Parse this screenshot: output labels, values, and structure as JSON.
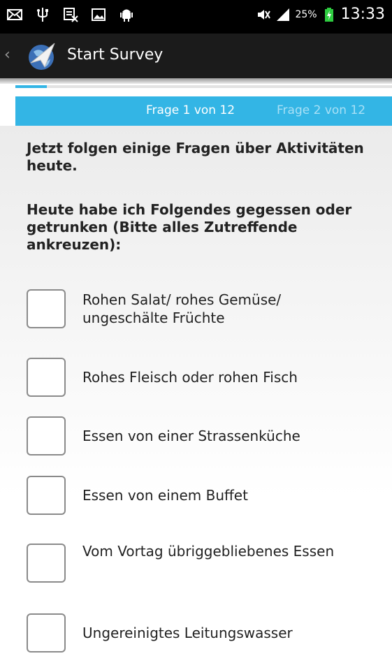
{
  "status_bar": {
    "battery_percent": "25%",
    "time": "13:33",
    "left_icons": [
      "mail-icon",
      "usb-icon",
      "sim-icon",
      "image-icon",
      "android-icon"
    ],
    "right_icons": [
      "mute-icon",
      "signal-icon",
      "battery-icon"
    ]
  },
  "action_bar": {
    "title": "Start Survey",
    "icons": [
      "back-chevron-icon",
      "app-logo-icon"
    ]
  },
  "progress": {
    "value_fraction": 0.083
  },
  "pager": {
    "current": "Frage 1 von 12",
    "next": "Frage 2 von 12"
  },
  "survey": {
    "intro": "Jetzt folgen einige Fragen über Aktivitäten heute.",
    "question": "Heute habe ich Folgendes gegessen oder getrunken (Bitte alles Zutreffende ankreuzen):",
    "options": [
      {
        "label": "Rohen Salat/ rohes Gemüse/ ungeschälte Früchte",
        "checked": false
      },
      {
        "label": "Rohes Fleisch oder rohen Fisch",
        "checked": false
      },
      {
        "label": "Essen von einer Strassenküche",
        "checked": false
      },
      {
        "label": "Essen von einem Buffet",
        "checked": false
      },
      {
        "label": "Vom Vortag übriggebliebenes Essen",
        "checked": false
      },
      {
        "label": "Ungereinigtes Leitungswasser",
        "checked": false
      }
    ]
  },
  "colors": {
    "accent": "#33b5e5",
    "status_bar": "#000000",
    "action_bar": "#1b1b1b"
  }
}
